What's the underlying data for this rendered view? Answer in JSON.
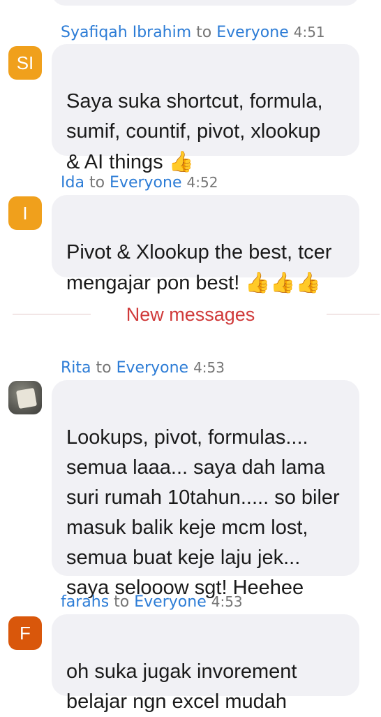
{
  "top_bubble": {},
  "messages": [
    {
      "sender": "Syafiqah Ibrahim",
      "to_word": "to",
      "recipient": "Everyone",
      "time": "4:51",
      "avatar_initials": "SI",
      "avatar_color": "#f0a01c",
      "text": "Saya suka shortcut, formula,\nsumif, countif, pivot, xlookup\n& AI things ",
      "emoji": "👍"
    },
    {
      "sender": "Ida",
      "to_word": "to",
      "recipient": "Everyone",
      "time": "4:52",
      "avatar_initials": "I",
      "avatar_color": "#f0a01c",
      "text": "Pivot & Xlookup the best, tcer\nmengajar pon best! ",
      "emoji": "👍👍👍"
    },
    {
      "sender": "Rita",
      "to_word": "to",
      "recipient": "Everyone",
      "time": "4:53",
      "avatar_initials": "",
      "avatar_icon": "profile-photo-icon",
      "text": "Lookups, pivot, formulas....\nsemua laaa... saya dah lama\nsuri rumah 10tahun..... so biler\nmasuk balik keje mcm lost,\nsemua buat keje laju jek...\nsaya selooow sgt! Heehee"
    },
    {
      "sender": "farahs",
      "to_word": "to",
      "recipient": "Everyone",
      "time": "4:53",
      "avatar_initials": "F",
      "avatar_color": "#d9570b",
      "text": "oh suka jugak invorement\nbelajar ngn excel mudah"
    }
  ],
  "divider": {
    "label": "New messages"
  },
  "colors": {
    "link": "#2c7cd6",
    "divider_label": "#d03a3a",
    "bubble": "#f1f1f5"
  }
}
